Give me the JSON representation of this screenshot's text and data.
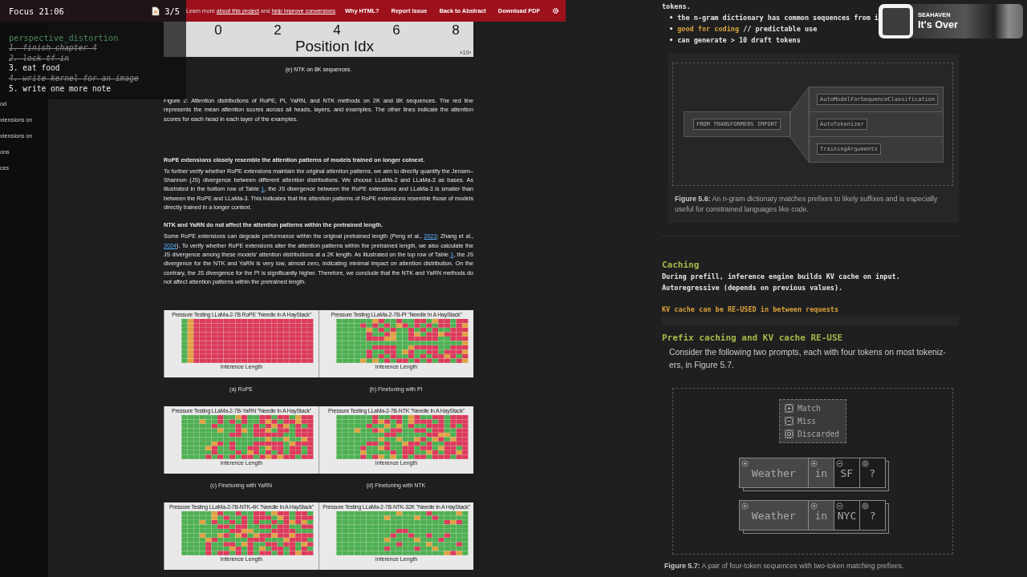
{
  "header": {
    "notice": [
      {
        "text": "Learn more "
      },
      {
        "link": "about this project"
      },
      {
        "text": " and "
      },
      {
        "link": "help improve conversions"
      },
      {
        "text": "."
      }
    ],
    "nav": [
      "Why HTML?",
      "Report Issue",
      "Back to Abstract",
      "Download PDF"
    ]
  },
  "focus_widget": {
    "title": "Focus 21:06",
    "counter": "3/5",
    "list_title": "perspective_distortion",
    "tasks": [
      {
        "text": "1. finish chapter 4",
        "done": true
      },
      {
        "text": "2. lock tf in",
        "done": true
      },
      {
        "text": "3. eat food",
        "done": false
      },
      {
        "text": "4. write kernel for an image",
        "done": true
      },
      {
        "text": "5. write one more note",
        "done": false
      }
    ]
  },
  "sidebar_toc": [
    "od",
    "xtensions on",
    "xtensions on",
    "ons",
    "ces"
  ],
  "paper": {
    "top_plot": {
      "xticks": [
        "0",
        "2",
        "4",
        "6",
        "8"
      ],
      "xlabel": "Position Idx",
      "exponent": "×10³"
    },
    "plot_caption": "(e) NTK on 8K sequences.",
    "figure_caption": "Figure 2: Attention distributions of RoPE, PI, YaRN, and NTK methods on 2K and 8K sequences. The red line represents the mean attention scores across all heads, layers, and examples. The other lines indicate the attention scores for each head in each layer of the examples.",
    "sections": [
      {
        "heading": "RoPE extensions closely resemble the attention patterns of models trained on longer cotnext.",
        "paragraph": [
          {
            "text": "To further verify whether RoPE extensions maintain the original attention patterns, we aim to directly quantify the Jensen–Shannon (JS) divergence between different attention distributions. We choose LLaMa-2 and LLaMa-3 as bases. As illustrated in the bottom row of Table "
          },
          {
            "link": "1"
          },
          {
            "text": ", the JS divergence between the RoPE extensions and LLaMa-3 is smaller than between the RoPE and LLaMa-3. This indicates that the attention patterns of RoPE extensions resemble those of models directly trained in a longer context."
          }
        ]
      },
      {
        "heading": "NTK and YaRN do not affect the attention patterns within the pretrained length.",
        "paragraph": [
          {
            "text": "Some RoPE extensions can degrade performance within the original pretrained length (Peng et al., "
          },
          {
            "link": "2023"
          },
          {
            "text": "; Zhang et al., "
          },
          {
            "link": "2024"
          },
          {
            "text": "). To verify whether RoPE extensions alter the attention patterns within the pretrained length, we also calculate the JS divergence among these models’ attention distributions at a 2K length. As illustrated on the top row of Table "
          },
          {
            "link": "1"
          },
          {
            "text": ", the JS divergence for the NTK and YaRN is very low, almost zero, indicating minimal impact on attention distribution. On the contrary, the JS divergence for the PI is significantly higher. Therefore, we conclude that the NTK and YaRN methods do not affect attention patterns within the pretrained length."
          }
        ]
      }
    ],
    "heatmaps": [
      {
        "title": "Pressure Testing LLaMa-2-7B RoPE \"Needle In A HayStack\"",
        "xlabel": "Inference Length",
        "kind": "red",
        "caption": "(a) RoPE"
      },
      {
        "title": "Pressure Testing LLaMa-2-7B-PI \"Needle In A HayStack\"",
        "xlabel": "Inference Length",
        "kind": "mixed",
        "caption": "(b) Finetuning with PI"
      },
      {
        "title": "Pressure Testing LLaMa-2-7B-YaRN \"Needle In A HayStack\"",
        "xlabel": "Inference Length",
        "kind": "mixed",
        "caption": "(c) Finetuning with YaRN"
      },
      {
        "title": "Pressure Testing LLaMa-2-7B-NTK \"Needle In A HayStack\"",
        "xlabel": "Inference Length",
        "kind": "mixed",
        "caption": "(d) Finetuning with NTK"
      },
      {
        "title": "Pressure Testing LLaMa-2-7B-NTK-4K \"Needle In A HayStack\"",
        "xlabel": "Inference Length",
        "kind": "mixed"
      },
      {
        "title": "Pressure Testing LLaMa-2-7B-NTK-32K \"Needle In A HayStack\"",
        "xlabel": "Inference Length",
        "kind": "green"
      }
    ]
  },
  "music": {
    "artist": "SEAHAVEN",
    "track": "It's Over"
  },
  "notes": {
    "intro": "tokens.",
    "bullets": [
      "• the n-gram dictionary has common sequences from i",
      "• **good for coding** // predictable use",
      "• can generate > 10 draft tokens"
    ],
    "figure_5_6": {
      "source": "FROM TRANSFORMERS IMPORT",
      "targets": [
        "AutoModelForSequenceClassification",
        "AutoTokenizer",
        "TrainingArguments"
      ],
      "caption": "**Figure 5.6:** An n-gram dictionary matches prefixes to likely suffixes and is especially useful for constrained languages like code."
    },
    "caching": {
      "heading": "Caching",
      "lines": [
        "During prefill, inference engine builds KV cache on input.",
        "Autoregressive (depends on previous values)."
      ],
      "highlight": "KV cache can be RE-USED in between requests"
    },
    "prefix": {
      "heading": "Prefix caching and KV cache RE-USE",
      "paragraph": "Consider the following two prompts, each with four tokens on most tokeniz-\ners, in Figure 5.7."
    },
    "figure_5_7": {
      "legend": [
        {
          "kind": "match",
          "label": "Match"
        },
        {
          "kind": "miss",
          "label": "Miss"
        },
        {
          "kind": "discarded",
          "label": "Discarded"
        }
      ],
      "sequences": [
        {
          "tokens": [
            {
              "text": "Weather",
              "kind": "match"
            },
            {
              "text": "in",
              "kind": "match"
            },
            {
              "text": "SF",
              "kind": "miss"
            },
            {
              "text": "?",
              "kind": "discarded"
            }
          ]
        },
        {
          "tokens": [
            {
              "text": "Weather",
              "kind": "match"
            },
            {
              "text": "in",
              "kind": "match"
            },
            {
              "text": "NYC",
              "kind": "miss"
            },
            {
              "text": "?",
              "kind": "discarded"
            }
          ]
        }
      ],
      "caption": "**Figure 5.7:** A pair of four-token sequences with two-token matching prefixes."
    }
  }
}
